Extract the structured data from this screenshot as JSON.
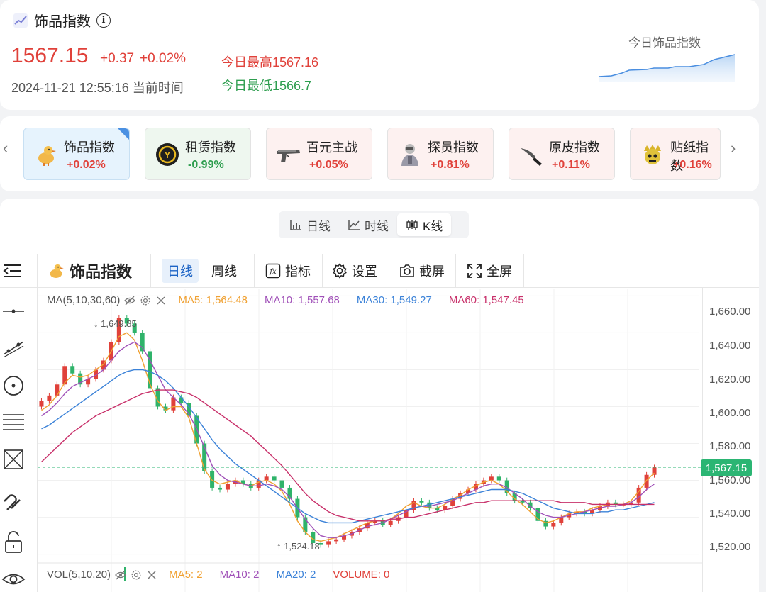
{
  "header": {
    "title": "饰品指数",
    "price": "1567.15",
    "change_abs": "+0.37",
    "change_pct": "+0.02%",
    "datetime": "2024-11-21 12:55:16 当前时间",
    "today_high": "今日最高1567.16",
    "today_low": "今日最低1566.7",
    "mini_title": "今日饰品指数",
    "up_color": "#e0413a",
    "down_color": "#2e9e4f"
  },
  "categories": [
    {
      "name": "饰品指数",
      "pct": "+0.02%",
      "icon": "duck-icon",
      "trend": "up",
      "active": true
    },
    {
      "name": "租赁指数",
      "pct": "-0.99%",
      "icon": "rent-coin-icon",
      "trend": "down"
    },
    {
      "name": "百元主战",
      "pct": "+0.05%",
      "icon": "pistol-icon",
      "trend": "up"
    },
    {
      "name": "探员指数",
      "pct": "+0.81%",
      "icon": "agent-icon",
      "trend": "up"
    },
    {
      "name": "原皮指数",
      "pct": "+0.11%",
      "icon": "knife-icon",
      "trend": "up"
    },
    {
      "name": "贴纸指数",
      "pct": "+0.16%",
      "icon": "sticker-skull-icon",
      "trend": "up"
    }
  ],
  "view_switch": {
    "items": [
      "日线",
      "时线",
      "K线"
    ],
    "active": "K线"
  },
  "toolbar": {
    "title": "饰品指数",
    "day": "日线",
    "week": "周线",
    "indicator": "指标",
    "settings": "设置",
    "screenshot": "截屏",
    "fullscreen": "全屏"
  },
  "ma_legend": {
    "label": "MA(5,10,30,60)",
    "ma5": "MA5: 1,564.48",
    "ma10": "MA10: 1,557.68",
    "ma30": "MA30: 1,549.27",
    "ma60": "MA60: 1,547.45",
    "colors": {
      "ma5": "#f0a030",
      "ma10": "#a050b8",
      "ma30": "#3b82d8",
      "ma60": "#c8306a"
    }
  },
  "vol_legend": {
    "label": "VOL(5,10,20)",
    "ma5": "MA5: 2",
    "ma10": "MA10: 2",
    "ma20": "MA20: 2",
    "volume": "VOLUME: 0"
  },
  "y_ticks": [
    "1,660.00",
    "1,640.00",
    "1,620.00",
    "1,600.00",
    "1,580.00",
    "1,560.00",
    "1,540.00",
    "1,520.00"
  ],
  "current_price_tag": "1,567.15",
  "high_label": "1,649.85",
  "low_label": "1,524.18",
  "chart_data": {
    "type": "line",
    "ylim": [
      1516,
      1664
    ],
    "y_ticks": [
      1660,
      1640,
      1620,
      1600,
      1580,
      1560,
      1540,
      1520
    ],
    "current": 1567.15,
    "high": 1649.85,
    "low": 1524.18,
    "close": [
      1603,
      1606,
      1612,
      1622,
      1618,
      1612,
      1615,
      1620,
      1625,
      1635,
      1648,
      1645,
      1640,
      1630,
      1610,
      1600,
      1598,
      1605,
      1602,
      1595,
      1580,
      1565,
      1556,
      1555,
      1558,
      1560,
      1558,
      1556,
      1560,
      1562,
      1560,
      1556,
      1550,
      1540,
      1532,
      1526,
      1525,
      1527,
      1528,
      1530,
      1532,
      1534,
      1537,
      1538,
      1536,
      1538,
      1540,
      1544,
      1549,
      1548,
      1545,
      1544,
      1546,
      1550,
      1553,
      1555,
      1558,
      1560,
      1562,
      1560,
      1553,
      1549,
      1548,
      1545,
      1538,
      1535,
      1537,
      1540,
      1542,
      1543,
      1542,
      1544,
      1546,
      1548,
      1547,
      1547,
      1548,
      1556,
      1563,
      1567
    ],
    "series": [
      {
        "name": "MA5",
        "values": [
          1598,
          1601,
          1606,
          1613,
          1617,
          1616,
          1617,
          1620,
          1623,
          1630,
          1638,
          1640,
          1636,
          1625,
          1612,
          1603,
          1598,
          1600,
          1600,
          1594,
          1580,
          1566,
          1560,
          1558,
          1559,
          1560,
          1558,
          1557,
          1559,
          1560,
          1558,
          1554,
          1547,
          1538,
          1532,
          1528,
          1527,
          1528,
          1529,
          1531,
          1533,
          1535,
          1537,
          1538,
          1538,
          1539,
          1542,
          1546,
          1548,
          1546,
          1545,
          1545,
          1547,
          1550,
          1552,
          1555,
          1557,
          1559,
          1560,
          1558,
          1554,
          1550,
          1547,
          1543,
          1539,
          1537,
          1538,
          1540,
          1542,
          1543,
          1543,
          1545,
          1546,
          1547,
          1547,
          1547,
          1549,
          1554,
          1560,
          1564
        ]
      },
      {
        "name": "MA10",
        "values": [
          1595,
          1598,
          1602,
          1607,
          1611,
          1613,
          1615,
          1617,
          1620,
          1625,
          1630,
          1633,
          1635,
          1632,
          1625,
          1617,
          1609,
          1605,
          1601,
          1596,
          1588,
          1578,
          1568,
          1563,
          1560,
          1559,
          1558,
          1557,
          1557,
          1558,
          1557,
          1555,
          1551,
          1545,
          1539,
          1534,
          1530,
          1529,
          1529,
          1530,
          1531,
          1533,
          1535,
          1536,
          1537,
          1539,
          1541,
          1543,
          1545,
          1546,
          1546,
          1547,
          1548,
          1549,
          1551,
          1553,
          1555,
          1557,
          1558,
          1558,
          1556,
          1553,
          1550,
          1546,
          1543,
          1541,
          1540,
          1540,
          1541,
          1542,
          1543,
          1544,
          1545,
          1546,
          1546,
          1547,
          1548,
          1551,
          1555,
          1558
        ]
      },
      {
        "name": "MA30",
        "values": [
          1588,
          1590,
          1593,
          1596,
          1599,
          1602,
          1605,
          1608,
          1611,
          1614,
          1617,
          1619,
          1620,
          1620,
          1619,
          1617,
          1614,
          1610,
          1605,
          1600,
          1594,
          1588,
          1582,
          1577,
          1573,
          1569,
          1566,
          1563,
          1560,
          1557,
          1554,
          1551,
          1548,
          1545,
          1542,
          1540,
          1538,
          1537,
          1537,
          1537,
          1537,
          1538,
          1539,
          1540,
          1541,
          1542,
          1543,
          1544,
          1545,
          1546,
          1547,
          1548,
          1549,
          1550,
          1551,
          1552,
          1553,
          1554,
          1555,
          1555,
          1555,
          1554,
          1553,
          1551,
          1549,
          1547,
          1545,
          1544,
          1543,
          1542,
          1542,
          1542,
          1543,
          1543,
          1544,
          1544,
          1545,
          1546,
          1547,
          1548
        ]
      },
      {
        "name": "MA60",
        "values": [
          1570,
          1574,
          1578,
          1582,
          1586,
          1589,
          1592,
          1595,
          1597,
          1599,
          1601,
          1603,
          1605,
          1607,
          1608,
          1609,
          1609,
          1609,
          1608,
          1607,
          1605,
          1602,
          1599,
          1596,
          1593,
          1590,
          1587,
          1584,
          1580,
          1576,
          1572,
          1568,
          1563,
          1558,
          1553,
          1549,
          1546,
          1543,
          1541,
          1540,
          1539,
          1538,
          1538,
          1538,
          1538,
          1539,
          1539,
          1540,
          1540,
          1541,
          1542,
          1543,
          1544,
          1545,
          1546,
          1547,
          1548,
          1548,
          1549,
          1549,
          1549,
          1549,
          1549,
          1549,
          1549,
          1549,
          1549,
          1548,
          1548,
          1548,
          1548,
          1547,
          1547,
          1547,
          1547,
          1547,
          1547,
          1547,
          1547,
          1547
        ]
      }
    ]
  }
}
